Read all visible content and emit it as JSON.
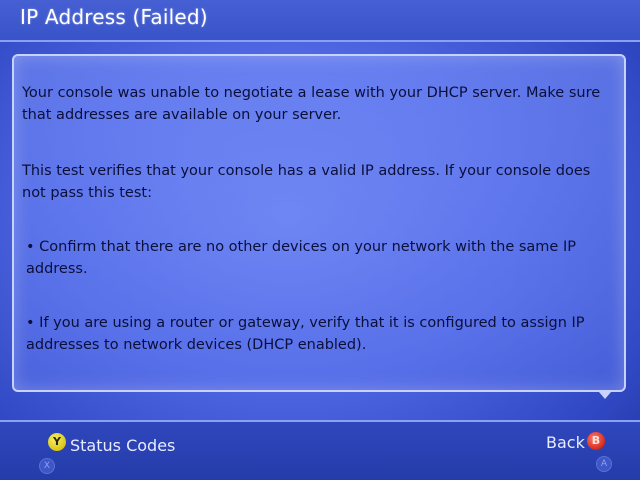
{
  "header": {
    "title": "IP Address (Failed)"
  },
  "content": {
    "paragraphs": [
      "Your console was unable to negotiate a lease with your DHCP server. Make sure that addresses are available on your server.",
      "This test verifies that your console has a valid IP address. If your console does not pass this test:",
      "• Confirm that there are no other devices on your network with the same IP address.",
      "• If you are using a router or gateway, verify that it is configured to assign IP addresses to network devices (DHCP enabled)."
    ]
  },
  "footer": {
    "y_button_glyph": "Y",
    "status_codes_label": "Status Codes",
    "x_button_glyph": "X",
    "back_label": "Back",
    "b_button_glyph": "B",
    "a_button_glyph": "A"
  },
  "icons": {
    "scroll_indicator": "chevron-down-icon"
  },
  "colors": {
    "y_button": "#d8c617",
    "b_button": "#d62a1e",
    "screen_blue": "#4f66e2"
  }
}
